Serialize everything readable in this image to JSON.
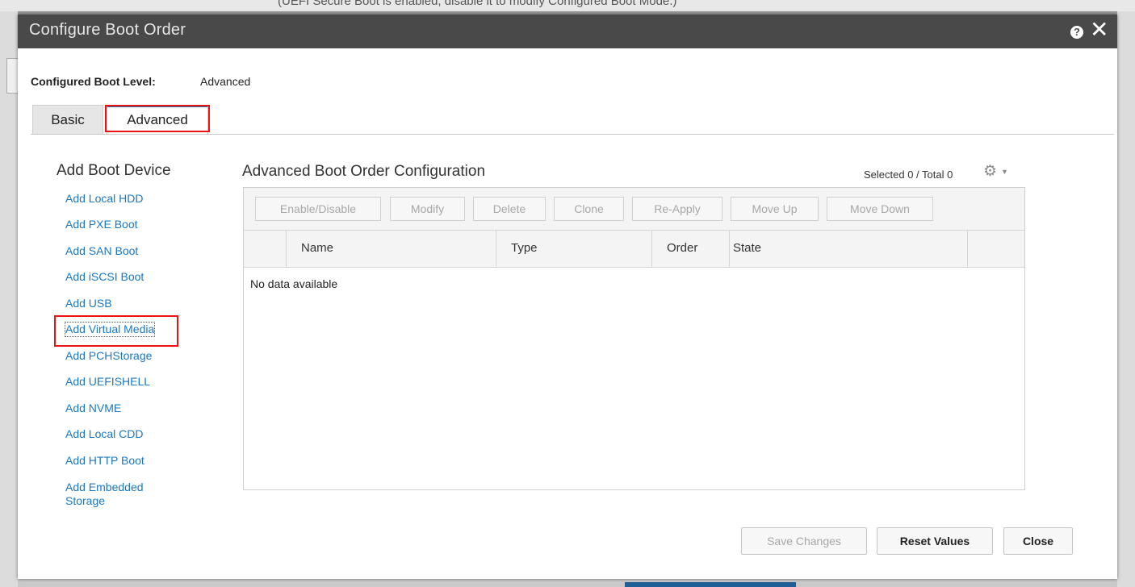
{
  "background": {
    "notice": "(UEFI Secure Boot is enabled, disable it to modify Configured Boot Mode.)"
  },
  "dialog": {
    "title": "Configure Boot Order",
    "help_icon": "question-circle-icon",
    "close_label": "✕"
  },
  "boot_level": {
    "label": "Configured Boot Level:",
    "value": "Advanced"
  },
  "tabs": [
    {
      "label": "Basic",
      "selected": false
    },
    {
      "label": "Advanced",
      "selected": true
    }
  ],
  "sidebar": {
    "heading": "Add Boot Device",
    "items": [
      {
        "label": "Add Local HDD"
      },
      {
        "label": "Add PXE Boot"
      },
      {
        "label": "Add SAN Boot"
      },
      {
        "label": "Add iSCSI Boot"
      },
      {
        "label": "Add USB"
      },
      {
        "label": "Add Virtual Media",
        "highlighted": true
      },
      {
        "label": "Add PCHStorage"
      },
      {
        "label": "Add UEFISHELL"
      },
      {
        "label": "Add NVME"
      },
      {
        "label": "Add Local CDD"
      },
      {
        "label": "Add HTTP Boot"
      },
      {
        "label": "Add Embedded Storage"
      }
    ]
  },
  "main": {
    "heading": "Advanced Boot Order Configuration",
    "selected_label": "Selected 0 / Total 0",
    "gear_icon": "gear-icon",
    "toolbar": [
      {
        "label": "Enable/Disable",
        "enabled": false
      },
      {
        "label": "Modify",
        "enabled": false
      },
      {
        "label": "Delete",
        "enabled": false
      },
      {
        "label": "Clone",
        "enabled": false
      },
      {
        "label": "Re-Apply",
        "enabled": false
      },
      {
        "label": "Move Up",
        "enabled": false
      },
      {
        "label": "Move Down",
        "enabled": false
      }
    ],
    "columns": [
      "Name",
      "Type",
      "Order",
      "State"
    ],
    "rows": [],
    "empty_message": "No data available"
  },
  "footer": {
    "save_label": "Save Changes",
    "reset_label": "Reset Values",
    "close_label": "Close"
  },
  "colors": {
    "link": "#1a78c2",
    "titlebar": "#494949",
    "highlight_border": "#ee1111",
    "tab_accent": "#1f6fb3"
  }
}
